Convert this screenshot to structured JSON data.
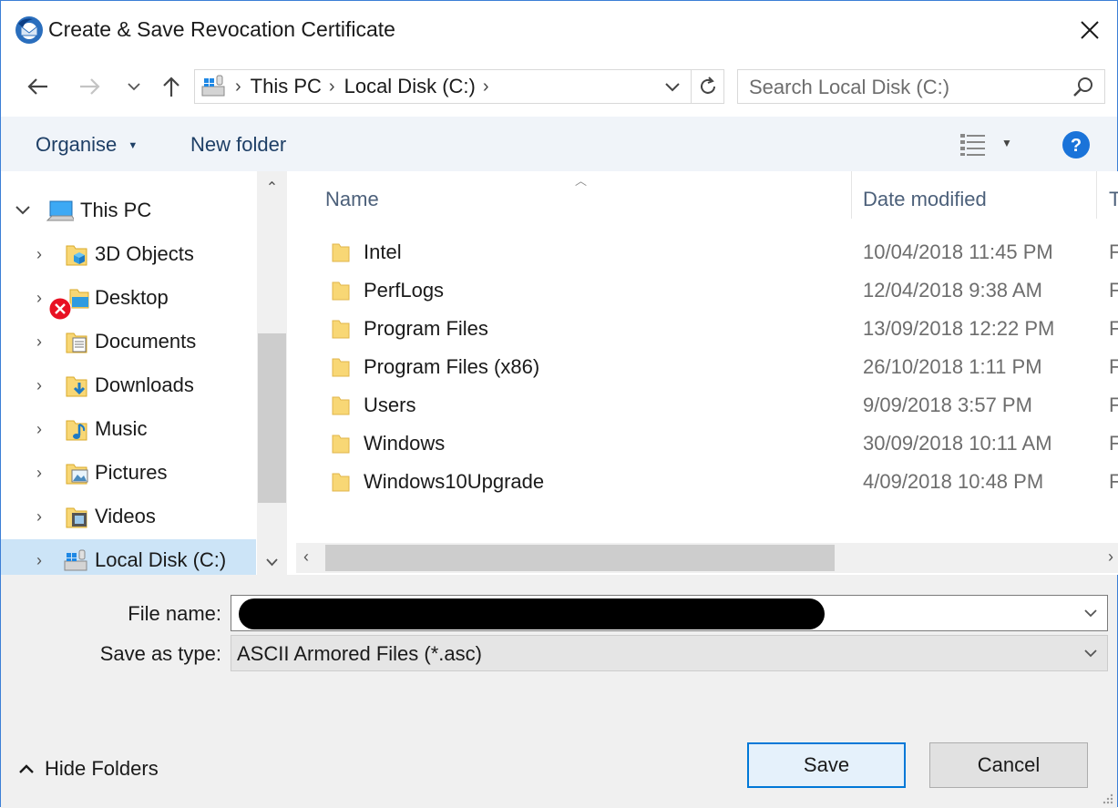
{
  "window": {
    "title": "Create & Save Revocation Certificate"
  },
  "address": {
    "crumbs": [
      "This PC",
      "Local Disk (C:)"
    ],
    "search_placeholder": "Search Local Disk (C:)"
  },
  "toolbar": {
    "organise_label": "Organise",
    "new_folder_label": "New folder"
  },
  "nav": {
    "root": {
      "label": "This PC",
      "icon": "computer-icon"
    },
    "items": [
      {
        "label": "3D Objects",
        "icon": "3d-objects-icon"
      },
      {
        "label": "Desktop",
        "icon": "desktop-icon"
      },
      {
        "label": "Documents",
        "icon": "documents-icon"
      },
      {
        "label": "Downloads",
        "icon": "downloads-icon"
      },
      {
        "label": "Music",
        "icon": "music-icon"
      },
      {
        "label": "Pictures",
        "icon": "pictures-icon"
      },
      {
        "label": "Videos",
        "icon": "videos-icon"
      },
      {
        "label": "Local Disk (C:)",
        "icon": "local-disk-icon",
        "selected": true
      }
    ]
  },
  "files": {
    "columns": {
      "name": "Name",
      "date": "Date modified",
      "type": "T"
    },
    "rows": [
      {
        "name": "Intel",
        "date": "10/04/2018 11:45 PM",
        "type": "F"
      },
      {
        "name": "PerfLogs",
        "date": "12/04/2018 9:38 AM",
        "type": "F"
      },
      {
        "name": "Program Files",
        "date": "13/09/2018 12:22 PM",
        "type": "F"
      },
      {
        "name": "Program Files (x86)",
        "date": "26/10/2018 1:11 PM",
        "type": "F"
      },
      {
        "name": "Users",
        "date": "9/09/2018 3:57 PM",
        "type": "F"
      },
      {
        "name": "Windows",
        "date": "30/09/2018 10:11 AM",
        "type": "F"
      },
      {
        "name": "Windows10Upgrade",
        "date": "4/09/2018 10:48 PM",
        "type": "F"
      }
    ]
  },
  "form": {
    "file_name_label": "File name:",
    "file_name_value": "",
    "save_as_type_label": "Save as type:",
    "save_as_type_value": "ASCII Armored Files (*.asc)"
  },
  "footer": {
    "hide_folders_label": "Hide Folders",
    "save_label": "Save",
    "cancel_label": "Cancel"
  },
  "colors": {
    "accent": "#0078d7",
    "selected": "#cce4f7",
    "folder": "#f8d775",
    "link": "#1e3f66"
  }
}
